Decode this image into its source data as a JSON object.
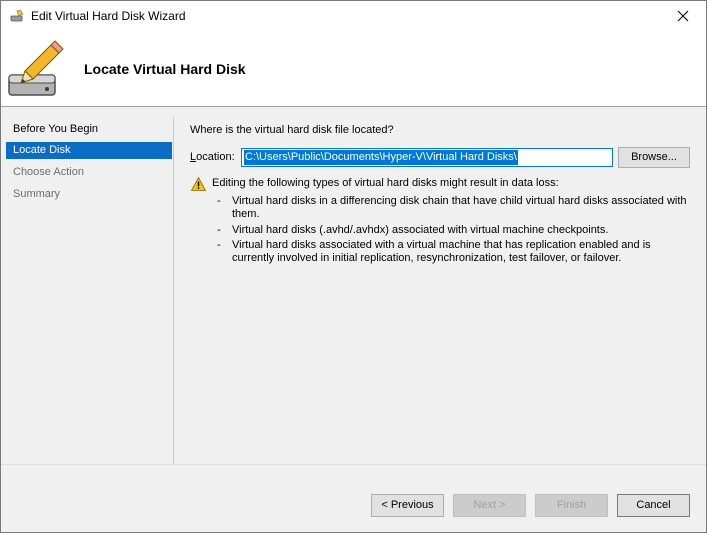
{
  "window": {
    "title": "Edit Virtual Hard Disk Wizard",
    "close_icon": "close-icon"
  },
  "header": {
    "title": "Locate Virtual Hard Disk",
    "icon": "disk-pencil-icon"
  },
  "sidebar": {
    "items": [
      {
        "label": "Before You Begin",
        "state": "normal"
      },
      {
        "label": "Locate Disk",
        "state": "selected"
      },
      {
        "label": "Choose Action",
        "state": "disabled"
      },
      {
        "label": "Summary",
        "state": "disabled"
      }
    ]
  },
  "main": {
    "question": "Where is the virtual hard disk file located?",
    "location_label": "Location:",
    "location_value": "C:\\Users\\Public\\Documents\\Hyper-V\\Virtual Hard Disks\\",
    "browse_label": "Browse...",
    "warning_text": "Editing the following types of virtual hard disks might result in data loss:",
    "warning_items": [
      "Virtual hard disks in a differencing disk chain that have child virtual hard disks associated with them.",
      "Virtual hard disks (.avhd/.avhdx) associated with virtual machine checkpoints.",
      "Virtual hard disks associated with a virtual machine that has replication enabled and is currently involved in initial replication, resynchronization, test failover, or failover."
    ]
  },
  "footer": {
    "previous_label": "< Previous",
    "next_label": "Next >",
    "finish_label": "Finish",
    "cancel_label": "Cancel"
  },
  "colors": {
    "selection": "#0a6cc4",
    "accent": "#0078d7",
    "warning": "#f0c419"
  }
}
